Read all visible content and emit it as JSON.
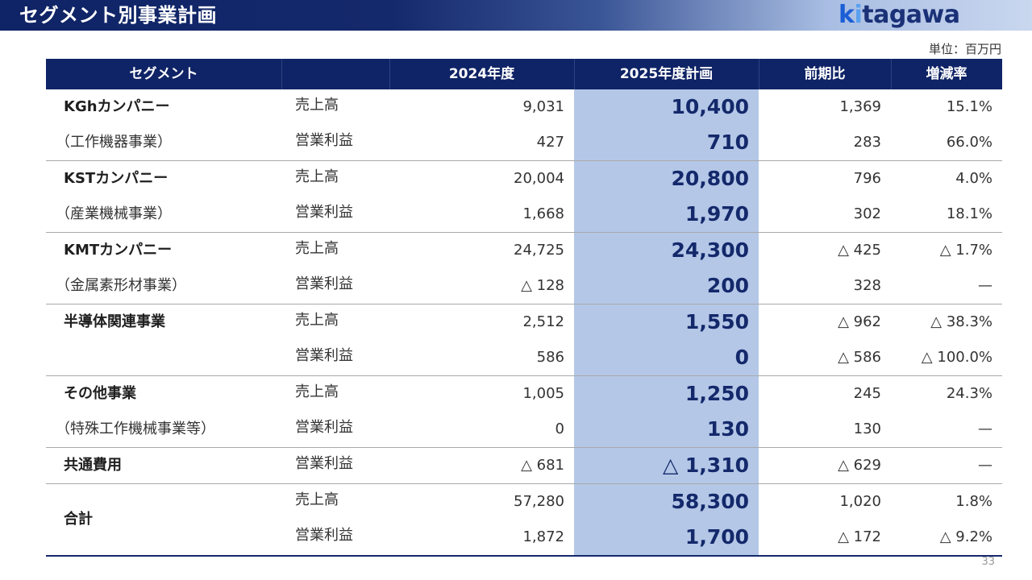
{
  "header": {
    "title": "セグメント別事業計画",
    "logo_k": "k",
    "logo_i": "i",
    "logo_rest": "tagawa"
  },
  "unit_label": "単位：百万円",
  "columns": {
    "segment": "セグメント",
    "y2024": "2024年度",
    "y2025": "2025年度計画",
    "yoy": "前期比",
    "rate": "増減率"
  },
  "segments": [
    {
      "name": "KGhカンパニー",
      "sub": "（工作機器事業）",
      "rows": [
        {
          "metric": "売上高",
          "y2024": "9,031",
          "y2025": "10,400",
          "yoy": "1,369",
          "rate": "15.1%"
        },
        {
          "metric": "営業利益",
          "y2024": "427",
          "y2025": "710",
          "yoy": "283",
          "rate": "66.0%"
        }
      ]
    },
    {
      "name": "KSTカンパニー",
      "sub": "（産業機械事業）",
      "rows": [
        {
          "metric": "売上高",
          "y2024": "20,004",
          "y2025": "20,800",
          "yoy": "796",
          "rate": "4.0%"
        },
        {
          "metric": "営業利益",
          "y2024": "1,668",
          "y2025": "1,970",
          "yoy": "302",
          "rate": "18.1%"
        }
      ]
    },
    {
      "name": "KMTカンパニー",
      "sub": "（金属素形材事業）",
      "rows": [
        {
          "metric": "売上高",
          "y2024": "24,725",
          "y2025": "24,300",
          "yoy": "△ 425",
          "rate": "△ 1.7%"
        },
        {
          "metric": "営業利益",
          "y2024": "△ 128",
          "y2025": "200",
          "yoy": "328",
          "rate": "—"
        }
      ]
    },
    {
      "name": "半導体関連事業",
      "sub": "",
      "rows": [
        {
          "metric": "売上高",
          "y2024": "2,512",
          "y2025": "1,550",
          "yoy": "△ 962",
          "rate": "△ 38.3%"
        },
        {
          "metric": "営業利益",
          "y2024": "586",
          "y2025": "0",
          "yoy": "△ 586",
          "rate": "△ 100.0%"
        }
      ]
    },
    {
      "name": "その他事業",
      "sub": "（特殊工作機械事業等）",
      "rows": [
        {
          "metric": "売上高",
          "y2024": "1,005",
          "y2025": "1,250",
          "yoy": "245",
          "rate": "24.3%"
        },
        {
          "metric": "営業利益",
          "y2024": "0",
          "y2025": "130",
          "yoy": "130",
          "rate": "—"
        }
      ]
    },
    {
      "name": "共通費用",
      "sub": "",
      "rows": [
        {
          "metric": "営業利益",
          "y2024": "△ 681",
          "y2025": "△ 1,310",
          "yoy": "△ 629",
          "rate": "—"
        }
      ]
    },
    {
      "name": "合計",
      "sub": "",
      "rows": [
        {
          "metric": "売上高",
          "y2024": "57,280",
          "y2025": "58,300",
          "yoy": "1,020",
          "rate": "1.8%"
        },
        {
          "metric": "営業利益",
          "y2024": "1,872",
          "y2025": "1,700",
          "yoy": "△ 172",
          "rate": "△ 9.2%"
        }
      ]
    }
  ],
  "page_number": "33"
}
